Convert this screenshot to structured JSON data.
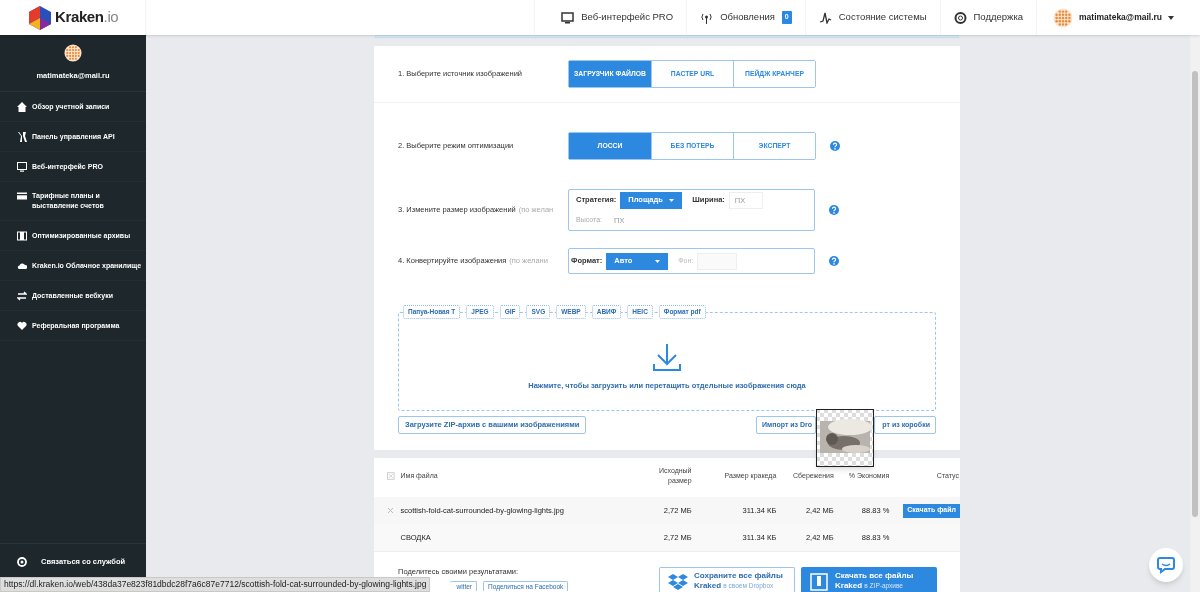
{
  "header": {
    "logo": {
      "name": "Kraken",
      "suffix": ".io"
    },
    "nav": [
      {
        "label": "Веб-интерфейс PRO"
      },
      {
        "label": "Обновления",
        "badge": "0"
      },
      {
        "label": "Состояние системы"
      },
      {
        "label": "Поддержка"
      }
    ],
    "user": "matimateka@mail.ru"
  },
  "sidebar": {
    "user": "matimateka@mail.ru",
    "items": [
      {
        "label": "Обзор учетной записи"
      },
      {
        "label": "Панель управления API"
      },
      {
        "label": "Веб-интерфейс PRO"
      },
      {
        "label": "Тарифные планы и выставление счетов"
      },
      {
        "label": "Оптимизированные архивы"
      },
      {
        "label": "Kraken.io Облачное хранилище"
      },
      {
        "label": "Доставленные вебхуки"
      },
      {
        "label": "Реферальная программа"
      }
    ],
    "footer": "Связаться со службой"
  },
  "steps": [
    {
      "kind": "choice",
      "label": "1. Выберите источник изображений",
      "help": false,
      "options": [
        {
          "label": "ЗАГРУЗЧИК ФАЙЛОВ",
          "selected": true
        },
        {
          "label": "ПАСТЕР URL",
          "selected": false
        },
        {
          "label": "ПЕЙДЖ КРАНЧЕР",
          "selected": false
        }
      ]
    },
    {
      "kind": "choice",
      "label": "2. Выберите режим оптимизации",
      "help": true,
      "options": [
        {
          "label": "ЛОССИ",
          "selected": true
        },
        {
          "label": "БЕЗ ПОТЕРЬ",
          "selected": false
        },
        {
          "label": "ЭКСПЕРТ",
          "selected": false
        }
      ]
    },
    {
      "kind": "resize",
      "label": "3. Измените размер изображений",
      "hint": "(по желан",
      "help": true,
      "strategy_label": "Стратегия:",
      "strategy": "Площадь",
      "width_label": "Ширина:",
      "width_placeholder": "ПХ",
      "height_label": "Высота:",
      "height_placeholder": "ПХ"
    },
    {
      "kind": "convert",
      "label": "4. Конвертируйте изображения",
      "hint": "(по желани",
      "help": true,
      "format_label": "Формат:",
      "format": "Авто",
      "background_label": "Фон:"
    }
  ],
  "formats": [
    "Папуа-Новая Т",
    "JPEG",
    "GIF",
    "SVG",
    "WEBP",
    "АВИФ",
    "HEIC",
    "Формат pdf"
  ],
  "dropzone": {
    "text": "Нажмите, чтобы загрузить или перетащить отдельные изображения сюда"
  },
  "upload_buttons": {
    "zip": "Загрузите ZIP-архив с вашими изображениями",
    "dropbox": "Импорт из Dro",
    "box": "рт из коробки"
  },
  "table": {
    "columns": [
      "Имя файла",
      "Исходный размер",
      "Размер кракеда",
      "Сбережения",
      "% Экономия",
      "Статус"
    ],
    "rows": [
      {
        "name": "scottish-fold-cat-surrounded-by-glowing-lights.jpg",
        "original": "2,72 МБ",
        "kraked": "311.34 КБ",
        "savings": "2,42 МБ",
        "percent": "88.83 %",
        "action": "Скачать файл"
      },
      {
        "name": "СВОДКА",
        "original": "2,72 МБ",
        "kraked": "311.34 КБ",
        "savings": "2,42 МБ",
        "percent": "88.83 %"
      }
    ]
  },
  "share": {
    "label": "Поделитесь своими результатами:",
    "buttons": [
      "witter",
      "Поделиться на Facebook"
    ]
  },
  "save_dropbox": {
    "title": "Сохраните все файлы",
    "brand": "Kraked",
    "sub": "в своем Dropbox"
  },
  "download_zip": {
    "title": "Скачать все файлы",
    "brand": "Kraked",
    "sub": "в ZIP-архиве"
  },
  "status_url": "https://dl.kraken.io/web/438da37e823f81dbdc28f7a6c87e7712/scottish-fold-cat-surrounded-by-glowing-lights.jpg"
}
